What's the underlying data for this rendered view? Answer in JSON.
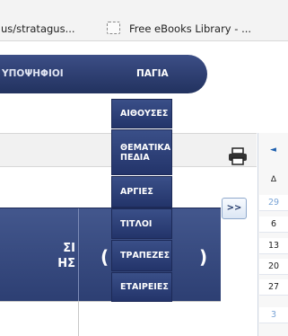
{
  "browser": {
    "bookmark_url": "us/stratagus...",
    "bookmark_library": "Free eBooks Library - ..."
  },
  "nav": {
    "candidates_label": "ΥΠΟΨΗΦΙΟΙ",
    "fixed_label": "ΠΑΓΙΑ"
  },
  "dropdown": {
    "items": [
      {
        "label": "ΑΙΘΟΥΣΕΣ"
      },
      {
        "label": "ΘΕΜΑΤΙΚΑ ΠΕΔΙΑ"
      },
      {
        "label": "ΑΡΓΙΕΣ"
      },
      {
        "label": "ΤΙΤΛΟΙ"
      },
      {
        "label": "ΤΡΑΠΕΖΕΣ"
      },
      {
        "label": "ΕΤΑΙΡΕΙΕΣ"
      }
    ]
  },
  "table": {
    "col1_header": "ΣΙ\nΗΣ",
    "col2_open": "(",
    "col2_close": ")"
  },
  "buttons": {
    "next_label": ">>"
  },
  "calendar": {
    "prev_arrow": "◄",
    "day_header": "Δ",
    "dates": [
      {
        "value": "29",
        "muted": true
      },
      {
        "value": "6",
        "muted": false
      },
      {
        "value": "13",
        "muted": false
      },
      {
        "value": "20",
        "muted": false
      },
      {
        "value": "27",
        "muted": false
      },
      {
        "value": "3",
        "muted": true
      }
    ]
  }
}
